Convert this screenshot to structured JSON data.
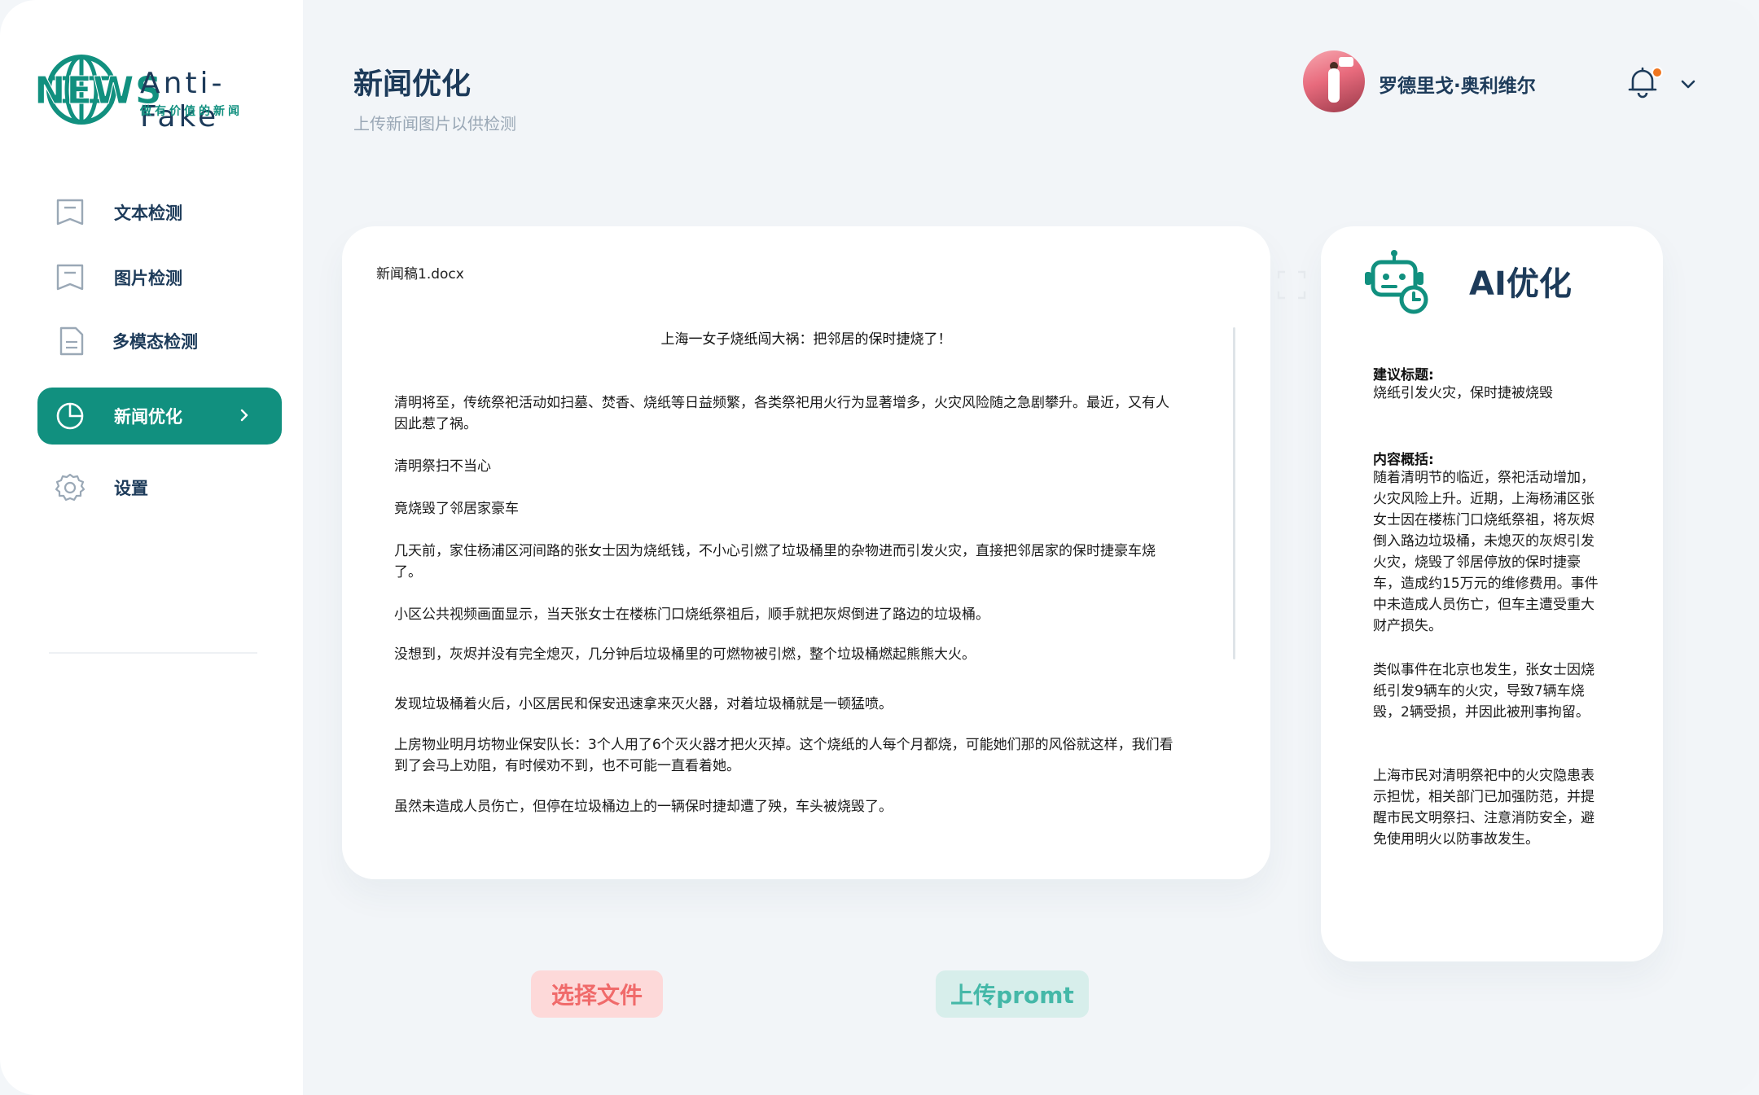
{
  "brand": {
    "logo_word": "NEWS",
    "name": "Anti-Fake",
    "slogan": "做有价值的新闻",
    "accent_color": "#11907f"
  },
  "sidebar": {
    "items": [
      {
        "label": "文本检测",
        "icon": "document-icon",
        "active": false
      },
      {
        "label": "图片检测",
        "icon": "image-document-icon",
        "active": false
      },
      {
        "label": "多模态检测",
        "icon": "file-icon",
        "active": false
      },
      {
        "label": "新闻优化",
        "icon": "pie-chart-icon",
        "active": true
      },
      {
        "label": "设置",
        "icon": "gear-icon",
        "active": false
      }
    ]
  },
  "header": {
    "title": "新闻优化",
    "subtitle": "上传新闻图片以供检测"
  },
  "user": {
    "name": "罗德里戈·奥利维尔",
    "has_notification": true
  },
  "document": {
    "filename": "新闻稿1.docx",
    "title": "上海一女子烧纸闯大祸：把邻居的保时捷烧了！",
    "paragraphs": [
      "清明将至，传统祭祀活动如扫墓、焚香、烧纸等日益频繁，各类祭祀用火行为显著增多，火灾风险随之急剧攀升。最近，又有人因此惹了祸。",
      "清明祭扫不当心",
      "竟烧毁了邻居家豪车",
      "几天前，家住杨浦区河间路的张女士因为烧纸钱，不小心引燃了垃圾桶里的杂物进而引发火灾，直接把邻居家的保时捷豪车烧了。",
      "小区公共视频画面显示，当天张女士在楼栋门口烧纸祭祖后，顺手就把灰烬倒进了路边的垃圾桶。",
      "没想到，灰烬并没有完全熄灭，几分钟后垃圾桶里的可燃物被引燃，整个垃圾桶燃起熊熊大火。",
      "发现垃圾桶着火后，小区居民和保安迅速拿来灭火器，对着垃圾桶就是一顿猛喷。",
      "上房物业明月坊物业保安队长：3个人用了6个灭火器才把火灭掉。这个烧纸的人每个月都烧，可能她们那的风俗就这样，我们看到了会马上劝阻，有时候劝不到，也不可能一直看着她。",
      "虽然未造成人员伤亡，但停在垃圾桶边上的一辆保时捷却遭了殃，车头被烧毁了。"
    ]
  },
  "ai": {
    "title": "AI优化",
    "suggested_title_label": "建议标题:",
    "suggested_title": "烧纸引发火灾，保时捷被烧毁",
    "summary_label": "内容概括:",
    "summary_paragraphs": [
      "随着清明节的临近，祭祀活动增加，火灾风险上升。近期，上海杨浦区张女士因在楼栋门口烧纸祭祖，将灰烬倒入路边垃圾桶，未熄灭的灰烬引发火灾，烧毁了邻居停放的保时捷豪车，造成约15万元的维修费用。事件中未造成人员伤亡，但车主遭受重大财产损失。",
      "类似事件在北京也发生，张女士因烧纸引发9辆车的火灾，导致7辆车烧毁，2辆受损，并因此被刑事拘留。",
      "上海市民对清明祭祀中的火灾隐患表示担忧，相关部门已加强防范，并提醒市民文明祭扫、注意消防安全，避免使用明火以防事故发生。"
    ]
  },
  "actions": {
    "select_file": "选择文件",
    "upload_prompt": "上传promt"
  }
}
